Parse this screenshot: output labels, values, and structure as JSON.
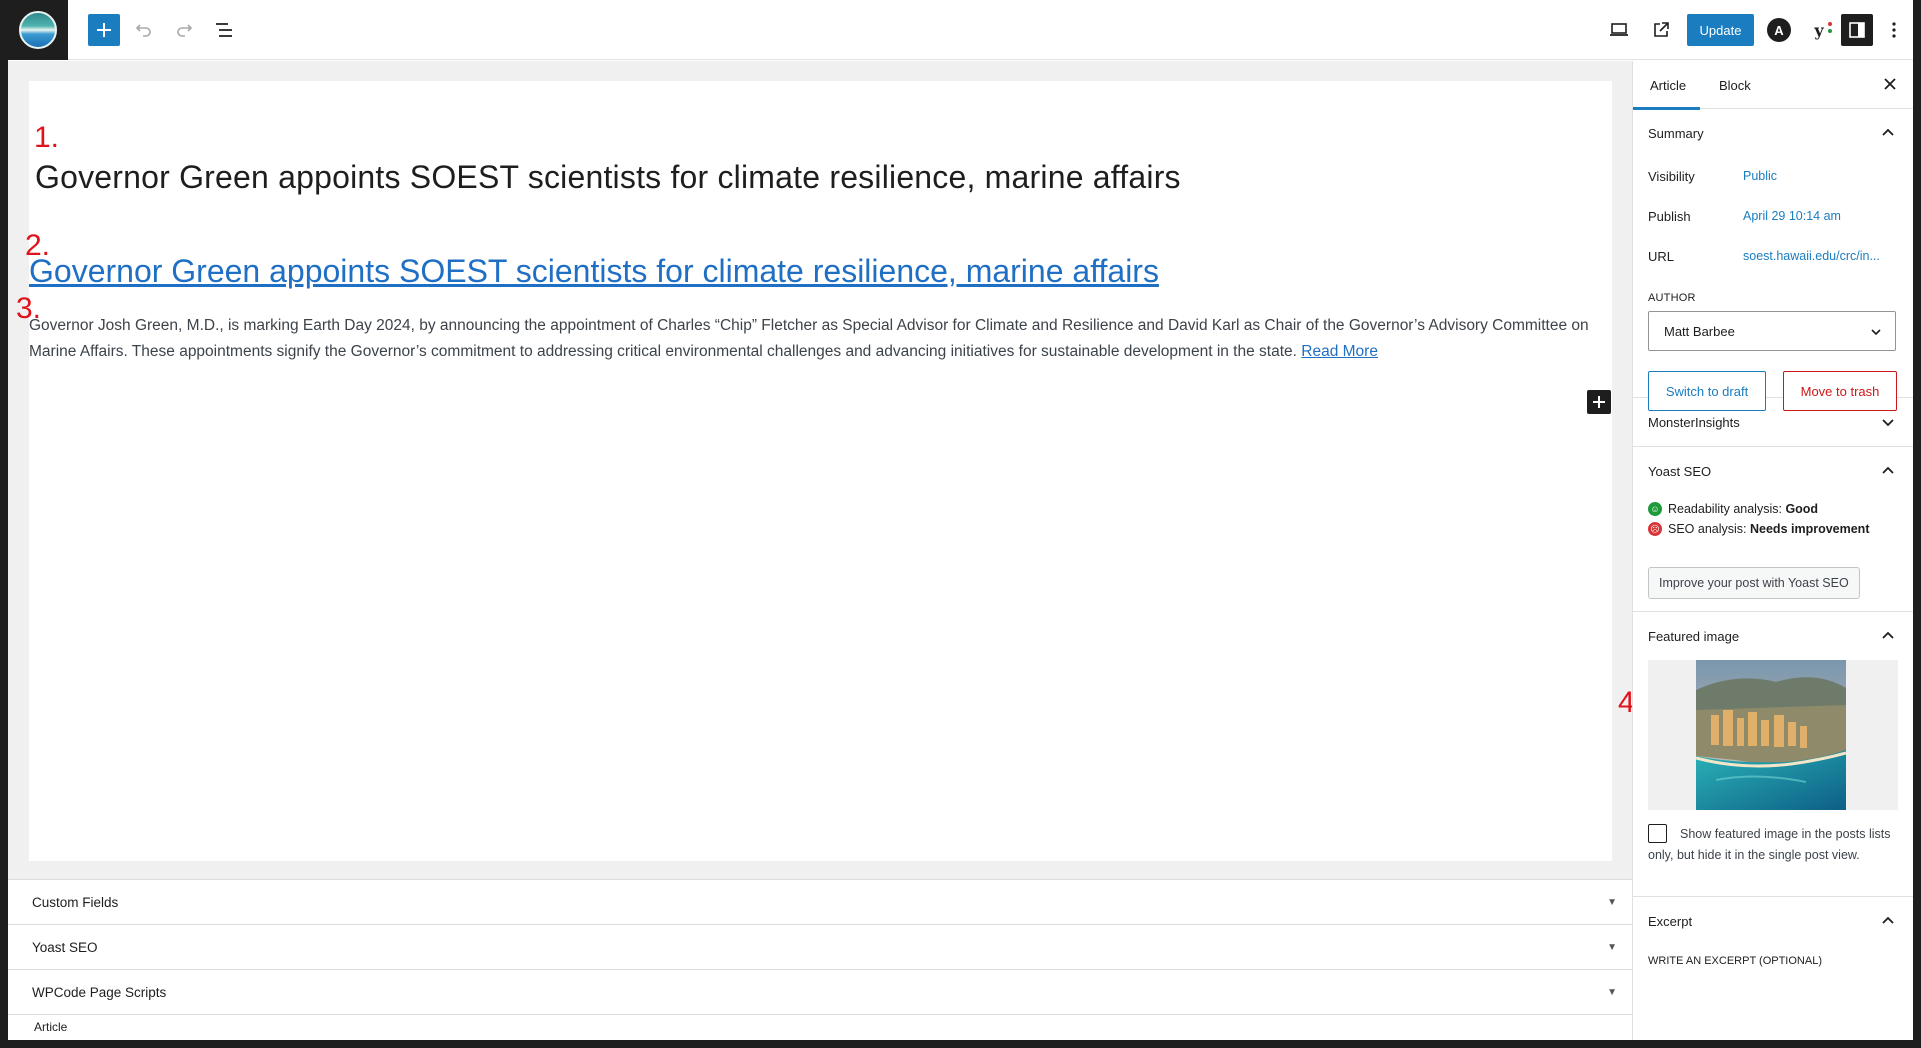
{
  "toolbar": {
    "add_icon": "plus-icon",
    "update_label": "Update",
    "astra_letter": "A",
    "yoast_letter": "y",
    "yoast_colors": [
      "#d63638",
      "#1e9a3a"
    ],
    "accent": "#1a7dbf"
  },
  "editor": {
    "annotations": [
      "1.",
      "2.",
      "3.",
      "4."
    ],
    "title": "Governor Green appoints SOEST scientists for climate resilience, marine affairs",
    "link_title": "Governor Green appoints SOEST scientists for climate resilience, marine affairs",
    "excerpt": "Governor Josh Green, M.D., is marking Earth Day 2024, by announcing the appointment of Charles “Chip” Fletcher as Special Advisor for Climate and Resilience and David Karl as Chair of the Governor’s Advisory Committee on Marine Affairs. These appointments signify the Governor’s commitment to addressing critical environmental challenges and advancing initiatives for sustainable development in the state.",
    "read_more": "Read More"
  },
  "metaboxes": {
    "items": [
      "Custom Fields",
      "Yoast SEO",
      "WPCode Page Scripts"
    ],
    "breadcrumb": "Article"
  },
  "sidebar": {
    "tabs": [
      "Article",
      "Block"
    ],
    "summary": {
      "title": "Summary",
      "visibility_label": "Visibility",
      "visibility_value": "Public",
      "publish_label": "Publish",
      "publish_value": "April 29 10:14 am",
      "url_label": "URL",
      "url_value": "soest.hawaii.edu/crc/in...",
      "author_label": "AUTHOR",
      "author_value": "Matt Barbee",
      "draft_button": "Switch to draft",
      "trash_button": "Move to trash"
    },
    "monsterinsights": {
      "title": "MonsterInsights"
    },
    "yoast": {
      "title": "Yoast SEO",
      "readability_label": "Readability analysis:",
      "readability_value": "Good",
      "seo_label": "SEO analysis:",
      "seo_value": "Needs improvement",
      "button": "Improve your post with Yoast SEO"
    },
    "featured_image": {
      "title": "Featured image",
      "checkbox_label": "Show featured image in the posts lists only, but hide it in the single post view."
    },
    "excerpt": {
      "title": "Excerpt",
      "label": "WRITE AN EXCERPT (OPTIONAL)"
    }
  }
}
